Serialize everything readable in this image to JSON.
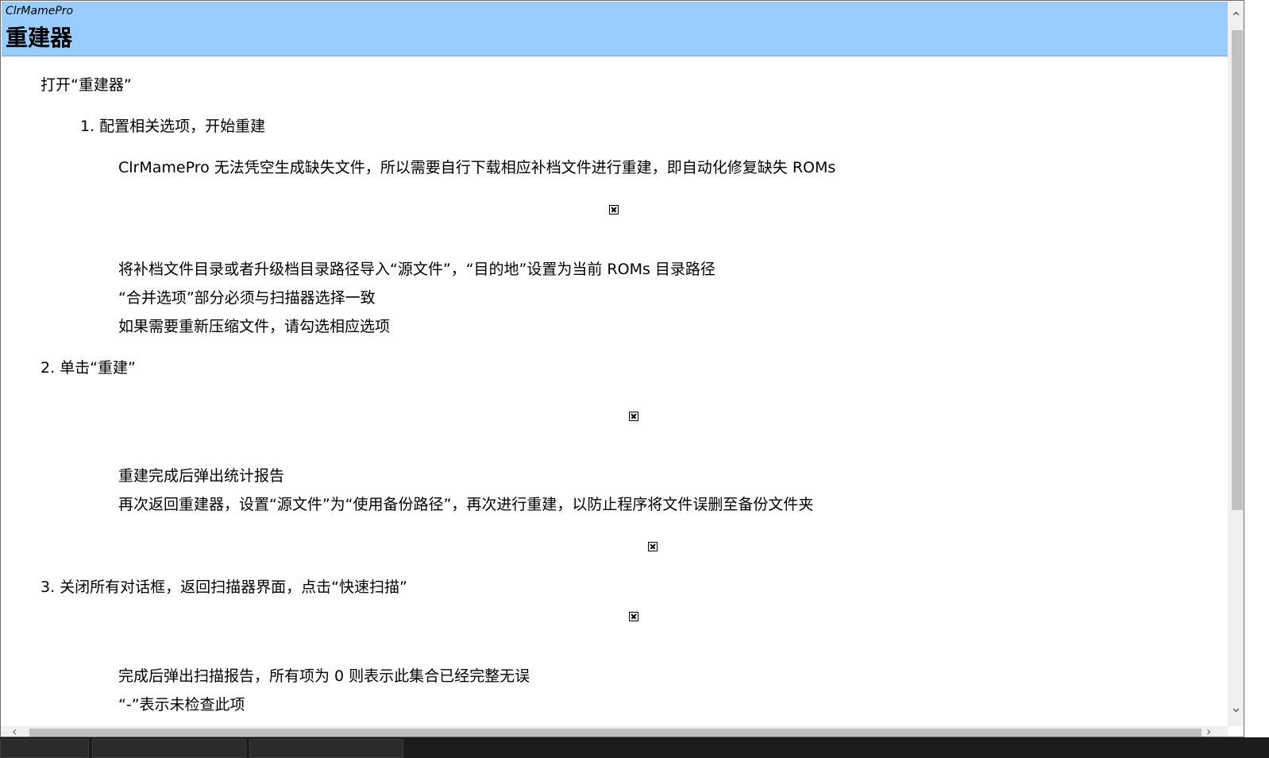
{
  "header": {
    "app_name": "ClrMamePro",
    "title": "重建器"
  },
  "content": {
    "intro": "打开“重建器”",
    "step1": {
      "heading": "1.  配置相关选项，开始重建",
      "note": "ClrMamePro 无法凭空生成缺失文件，所以需要自行下载相应补档文件进行重建，即自动化修复缺失 ROMs",
      "line1": "将补档文件目录或者升级档目录路径导入“源文件”，“目的地”设置为当前 ROMs 目录路径",
      "line2": "“合并选项”部分必须与扫描器选择一致",
      "line3": "如果需要重新压缩文件，请勾选相应选项"
    },
    "step2": {
      "heading": "2.  单击“重建”",
      "line1": "重建完成后弹出统计报告",
      "line2": "再次返回重建器，设置“源文件”为“使用备份路径”，再次进行重建，以防止程序将文件误删至备份文件夹"
    },
    "step3": {
      "heading": "3.  关闭所有对话框，返回扫描器界面，点击“快速扫描”",
      "line1": "完成后弹出扫描报告，所有项为 0 则表示此集合已经完整无误",
      "line2": "“-”表示未检查此项"
    }
  },
  "icons": {
    "broken_image": "broken-image-icon",
    "scroll_up": "chevron-up-icon",
    "scroll_down": "chevron-down-icon",
    "scroll_left": "chevron-left-icon",
    "scroll_right": "chevron-right-icon"
  },
  "colors": {
    "header_bg": "#99ccff",
    "scrollbar_bg": "#f0f0f0",
    "scroll_thumb": "#c0c0c0",
    "taskbar_bg": "#1c1c1c"
  }
}
